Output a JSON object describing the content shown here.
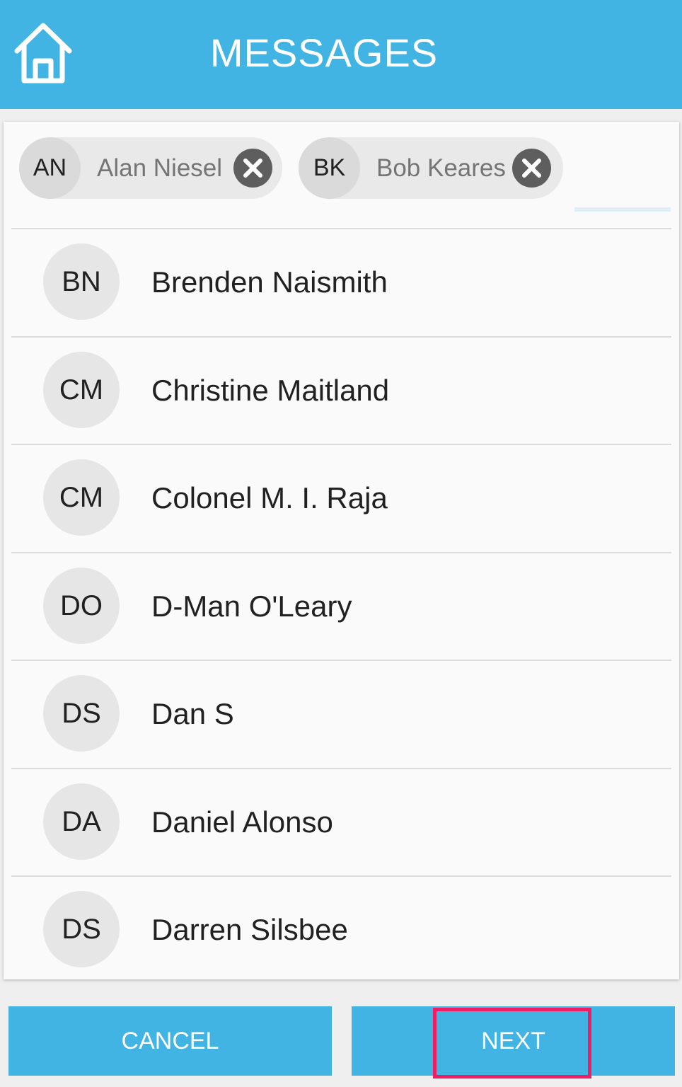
{
  "header": {
    "title": "MESSAGES",
    "home_icon": "home-icon",
    "background": "#41b4e3"
  },
  "selected_recipients": [
    {
      "initials": "AN",
      "name": "Alan Niesel",
      "remove_icon": "close-icon"
    },
    {
      "initials": "BK",
      "name": "Bob Keares",
      "remove_icon": "close-icon"
    }
  ],
  "contacts": [
    {
      "initials": "BN",
      "name": "Brenden Naismith"
    },
    {
      "initials": "CM",
      "name": "Christine Maitland"
    },
    {
      "initials": "CM",
      "name": "Colonel M. I. Raja"
    },
    {
      "initials": "DO",
      "name": "D-Man O'Leary"
    },
    {
      "initials": "DS",
      "name": "Dan S"
    },
    {
      "initials": "DA",
      "name": "Daniel Alonso"
    },
    {
      "initials": "DS",
      "name": "Darren Silsbee"
    }
  ],
  "footer": {
    "cancel_label": "CANCEL",
    "next_label": "NEXT",
    "highlight_color": "#ef1e63"
  }
}
